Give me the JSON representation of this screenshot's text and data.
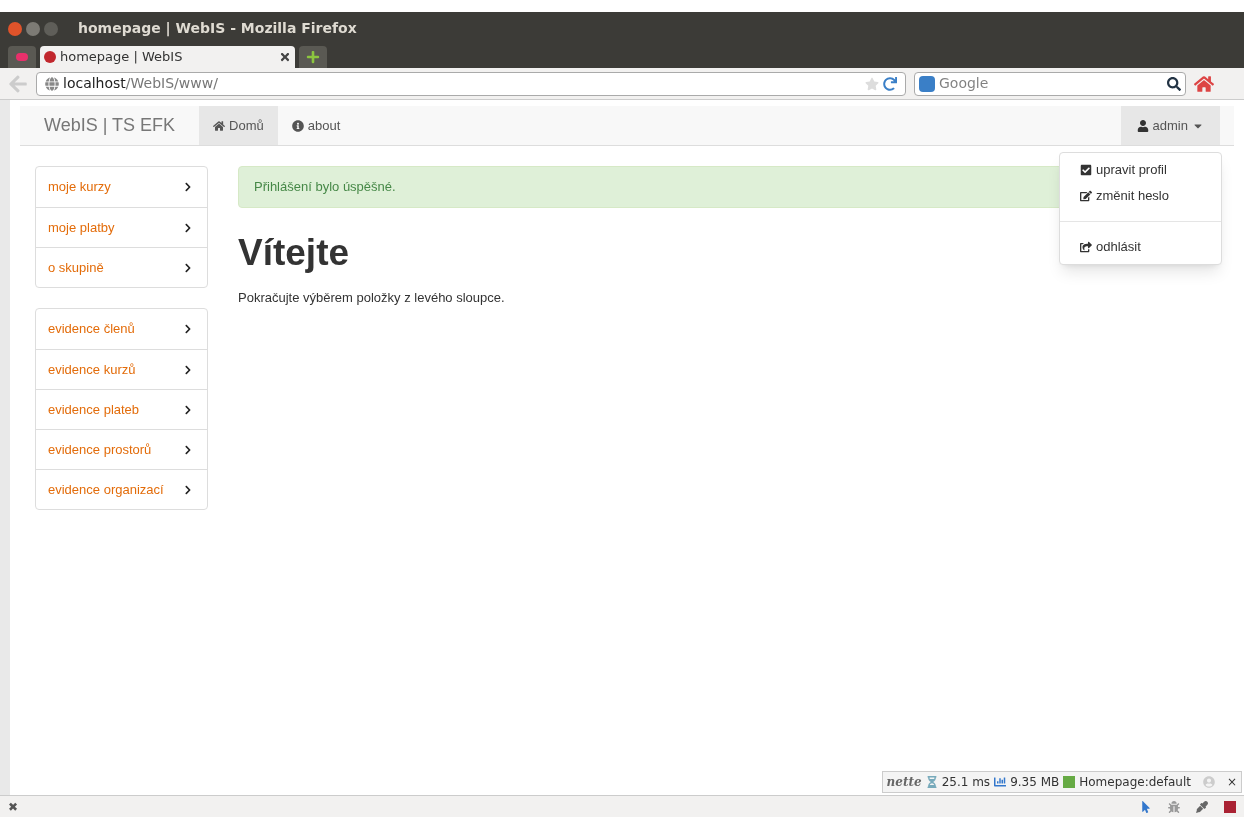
{
  "window": {
    "title": "homepage | WebIS - Mozilla Firefox"
  },
  "tabs": [
    {
      "label": "homepage | WebIS",
      "selected": true
    }
  ],
  "url_bar": {
    "host": "localhost",
    "path": "/WebIS/www/"
  },
  "search": {
    "placeholder": "Google"
  },
  "navbar": {
    "brand": "WebIS | TS EFK",
    "items": [
      {
        "label": "Domů",
        "selected": true,
        "kind": "home"
      },
      {
        "label": "about",
        "selected": false,
        "kind": "info"
      }
    ],
    "user": "admin"
  },
  "user_menu": [
    {
      "label": "upravit profil",
      "kind": "check"
    },
    {
      "label": "změnit heslo",
      "kind": "edit"
    },
    {
      "kind": "divider"
    },
    {
      "label": "odhlásit",
      "kind": "share"
    }
  ],
  "sidebar": {
    "groups": [
      [
        "moje kurzy",
        "moje platby",
        "o skupině"
      ],
      [
        "evidence členů",
        "evidence kurzů",
        "evidence plateb",
        "evidence prostorů",
        "evidence organizací"
      ]
    ]
  },
  "alert": "Přihlášení bylo úspěšné.",
  "heading": "Vítejte",
  "text": "Pokračujte výběrem položky z levého sloupce.",
  "debug_bar": {
    "brand": "nette",
    "time": "25.1 ms",
    "memory": "9.35 MB",
    "presenter": "Homepage:default",
    "close": "×"
  },
  "status_bar": {
    "close": "✖"
  }
}
